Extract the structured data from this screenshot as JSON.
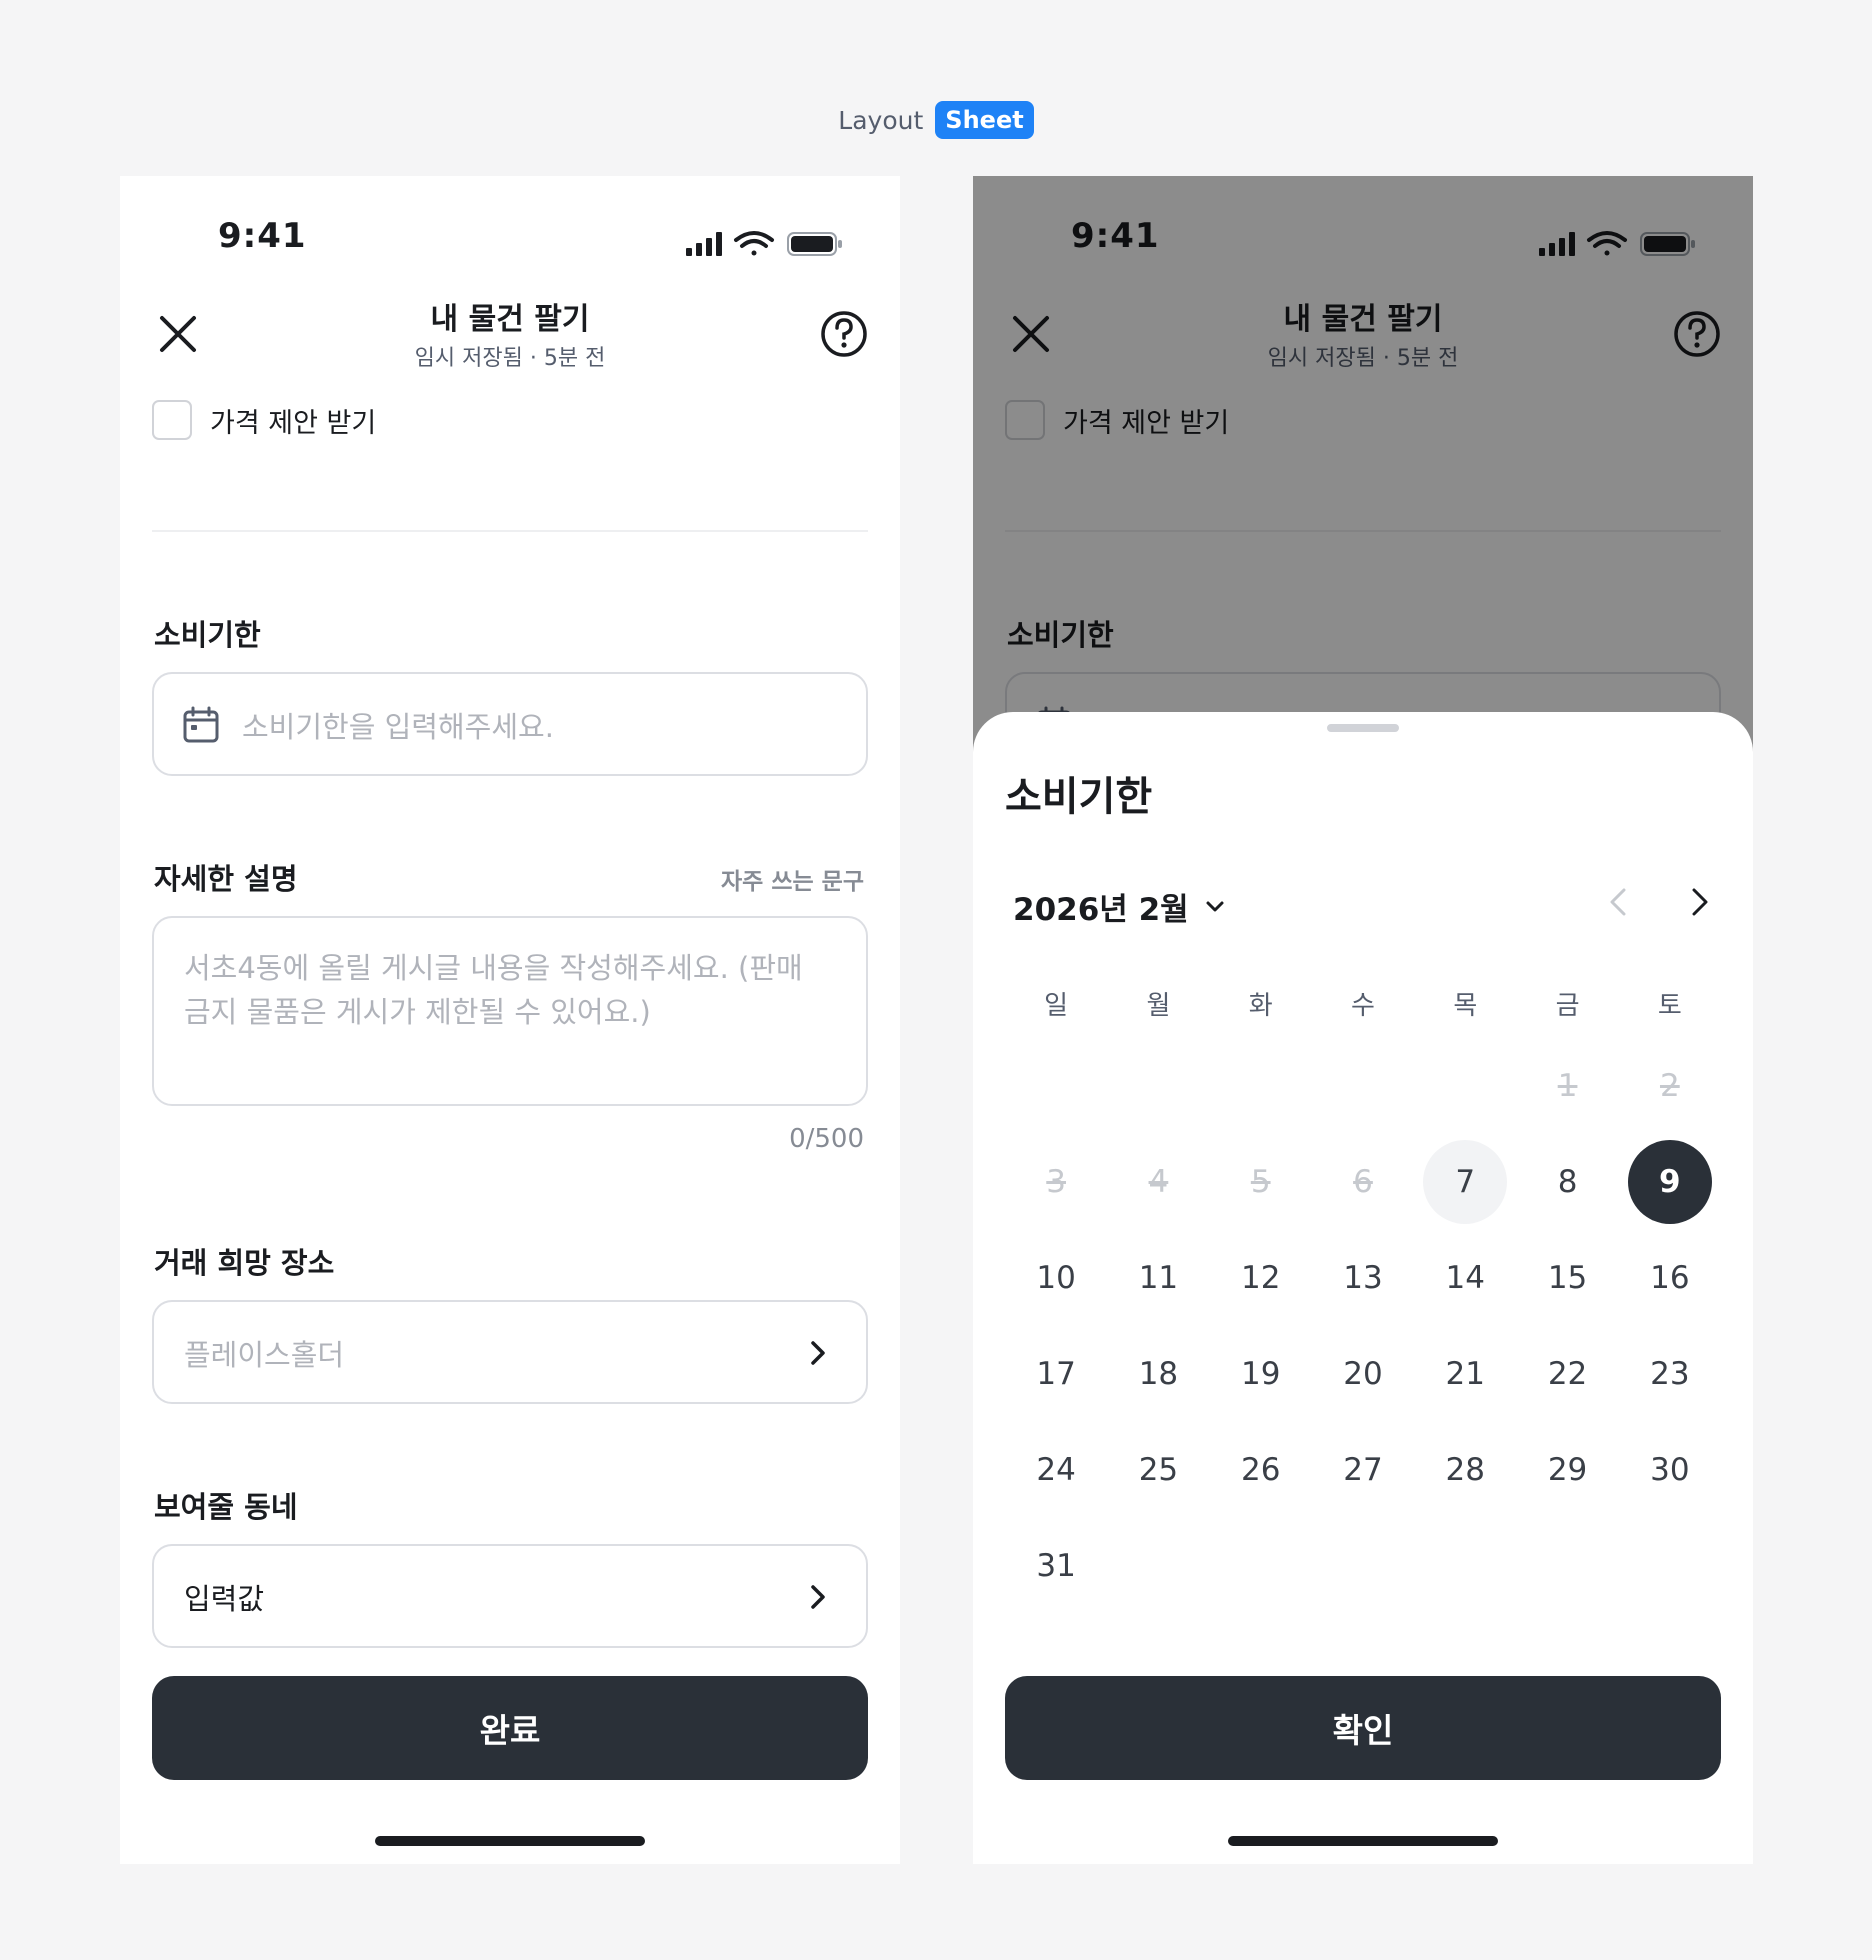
{
  "caption": {
    "label": "Layout",
    "badge": "Sheet"
  },
  "status_bar": {
    "time": "9:41"
  },
  "nav": {
    "title": "내 물건 팔기",
    "subtitle": "임시 저장됨 · 5분 전"
  },
  "form": {
    "price_offer_label": "가격 제안 받기",
    "expiry": {
      "label": "소비기한",
      "placeholder": "소비기한을 입력해주세요."
    },
    "description": {
      "label": "자세한 설명",
      "link": "자주 쓰는 문구",
      "placeholder_line1": "서초4동에 올릴 게시글 내용을 작성해주세요. (판매",
      "placeholder_line2": "금지 물품은 게시가 제한될 수 있어요.)",
      "counter": "0/500"
    },
    "place": {
      "label": "거래 희망 장소",
      "placeholder": "플레이스홀더"
    },
    "neighborhood": {
      "label": "보여줄 동네",
      "value": "입력값"
    },
    "submit_label": "완료"
  },
  "sheet": {
    "title": "소비기한",
    "month_label": "2026년 2월",
    "weekdays": [
      "일",
      "월",
      "화",
      "수",
      "목",
      "금",
      "토"
    ],
    "leading_blanks": 5,
    "days": [
      {
        "n": "1",
        "state": "disabled"
      },
      {
        "n": "2",
        "state": "disabled"
      },
      {
        "n": "3",
        "state": "disabled"
      },
      {
        "n": "4",
        "state": "disabled"
      },
      {
        "n": "5",
        "state": "disabled"
      },
      {
        "n": "6",
        "state": "disabled"
      },
      {
        "n": "7",
        "state": "today"
      },
      {
        "n": "8",
        "state": "normal"
      },
      {
        "n": "9",
        "state": "selected"
      },
      {
        "n": "10",
        "state": "normal"
      },
      {
        "n": "11",
        "state": "normal"
      },
      {
        "n": "12",
        "state": "normal"
      },
      {
        "n": "13",
        "state": "normal"
      },
      {
        "n": "14",
        "state": "normal"
      },
      {
        "n": "15",
        "state": "normal"
      },
      {
        "n": "16",
        "state": "normal"
      },
      {
        "n": "17",
        "state": "normal"
      },
      {
        "n": "18",
        "state": "normal"
      },
      {
        "n": "19",
        "state": "normal"
      },
      {
        "n": "20",
        "state": "normal"
      },
      {
        "n": "21",
        "state": "normal"
      },
      {
        "n": "22",
        "state": "normal"
      },
      {
        "n": "23",
        "state": "normal"
      },
      {
        "n": "24",
        "state": "normal"
      },
      {
        "n": "25",
        "state": "normal"
      },
      {
        "n": "26",
        "state": "normal"
      },
      {
        "n": "27",
        "state": "normal"
      },
      {
        "n": "28",
        "state": "normal"
      },
      {
        "n": "29",
        "state": "normal"
      },
      {
        "n": "30",
        "state": "normal"
      },
      {
        "n": "31",
        "state": "normal"
      }
    ],
    "confirm_label": "확인"
  },
  "colors": {
    "primary": "#2a3038",
    "accent": "#1e82f6",
    "background": "#f5f5f6",
    "placeholder": "#b0b3ba"
  },
  "icons": [
    "close-icon",
    "help-icon",
    "calendar-icon",
    "chevron-right-icon",
    "chevron-down-icon",
    "chevron-left-icon",
    "signal-icon",
    "wifi-icon",
    "battery-icon"
  ]
}
